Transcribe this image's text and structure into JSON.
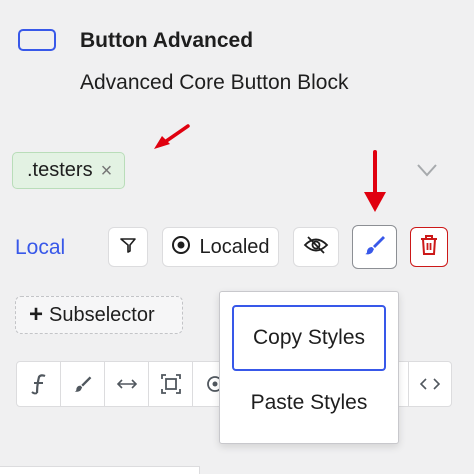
{
  "header": {
    "icon": "button-block-icon",
    "title": "Button Advanced",
    "description": "Advanced Core Button Block"
  },
  "class_chip": {
    "label": ".testers",
    "remove_glyph": "×"
  },
  "state_row": {
    "label": "Local",
    "localed_label": "Localed"
  },
  "subselector": {
    "plus": "+",
    "label": "Subselector"
  },
  "popover": {
    "items": [
      {
        "label": "Copy Styles",
        "focused": true
      },
      {
        "label": "Paste Styles",
        "focused": false
      }
    ]
  },
  "toolbar": {
    "icons": [
      "typography-icon",
      "brush-icon",
      "spacing-icon",
      "size-icon",
      "position-icon",
      "code-icon"
    ]
  },
  "colors": {
    "accent": "#3858e9",
    "arrow": "#e0000f",
    "danger": "#cc1818",
    "chip_bg": "#e3f2e3"
  }
}
